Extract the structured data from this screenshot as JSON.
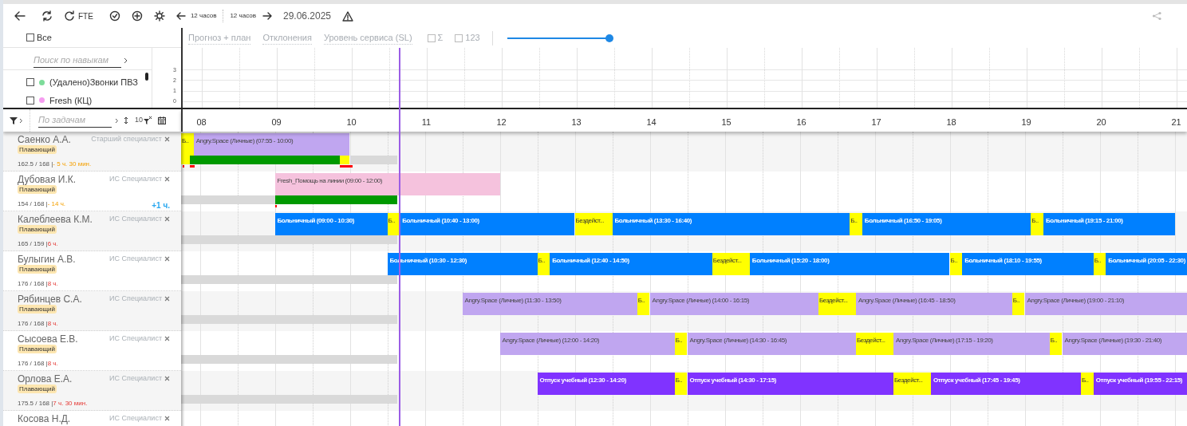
{
  "toolbar": {
    "fte_label": "FTE",
    "back_hours": "12 часов",
    "forward_hours": "12 часов",
    "date": "29.06.2025"
  },
  "view_tabs": {
    "select_all": {
      "label": "Все",
      "checked": false
    },
    "tabs": [
      {
        "label": "Прогноз + план",
        "selected": false
      },
      {
        "label": "Отклонения",
        "selected": false
      },
      {
        "label": "Уровень сервиса (SL)",
        "selected": false
      }
    ],
    "toggles": [
      {
        "label": "Σ",
        "checked": false
      },
      {
        "label": "123",
        "checked": false
      }
    ],
    "zoom_slider": {
      "level": 1
    }
  },
  "skills": {
    "search_placeholder": "Поиск по навыкам",
    "items": [
      {
        "label": "(Удалено)Звонки ПВЗ",
        "checked": false,
        "color": "#7ddc9a"
      },
      {
        "label": "Fresh (КЦ)",
        "checked": false,
        "color": "#f59cf0"
      }
    ]
  },
  "mini_chart": {
    "yticks": [
      "3",
      "2",
      "1",
      "0"
    ]
  },
  "task_filter": {
    "placeholder": "По задачам",
    "count": "10"
  },
  "timeline": {
    "hours": [
      "08",
      "09",
      "10",
      "11",
      "12",
      "13",
      "14",
      "15",
      "16",
      "17",
      "18",
      "19",
      "20",
      "21"
    ]
  },
  "employees": [
    {
      "name": "Саенко А.А.",
      "role": "Старший специалист",
      "badge": "Плавающий",
      "hours": "162.5 / 168 |",
      "delta": "- 5 ч. 30 мин.",
      "kind": "under",
      "shifts": [
        {
          "kind": "break",
          "label": "Б.."
        },
        {
          "kind": "personal",
          "label": "Angry.Space (Личные) (07:55 - 10:00)"
        }
      ],
      "adherence": [
        {
          "kind": "off"
        },
        {
          "kind": "ok"
        },
        {
          "kind": "off"
        },
        {
          "kind": "none"
        }
      ]
    },
    {
      "name": "Дубовая И.К.",
      "role": "ИС Специалист",
      "badge": "Плавающий",
      "hours": "154 / 168 |",
      "delta": "- 14 ч.",
      "kind": "under",
      "extra": "+1 ч.",
      "shifts": [
        {
          "kind": "task",
          "label": "Fresh_Помощь на линии (09:00 - 12:00)"
        }
      ],
      "adherence": [
        {
          "kind": "none"
        },
        {
          "kind": "ok"
        }
      ]
    },
    {
      "name": "Калеблеева К.М.",
      "role": "ИС Специалист",
      "badge": "Плавающий",
      "hours": "165 / 159 |",
      "delta": "6 ч.",
      "kind": "over",
      "shifts": [
        {
          "kind": "sick",
          "label": "Больничный (09:00 - 10:30)"
        },
        {
          "kind": "break",
          "label": "Б.."
        },
        {
          "kind": "sick",
          "label": "Больничный (10:40 - 13:00)"
        },
        {
          "kind": "break",
          "label": "Бездейст..."
        },
        {
          "kind": "sick",
          "label": "Больничный (13:30 - 16:40)"
        },
        {
          "kind": "break",
          "label": "Б.."
        },
        {
          "kind": "sick",
          "label": "Больничный (16:50 - 19:05)"
        },
        {
          "kind": "break",
          "label": "Б.."
        },
        {
          "kind": "sick",
          "label": "Больничный (19:15 - 21:00)"
        }
      ],
      "adherence": [
        {
          "kind": "none"
        }
      ]
    },
    {
      "name": "Булыгин А.В.",
      "role": "ИС Специалист",
      "badge": "Плавающий",
      "hours": "176 / 168 |",
      "delta": "8 ч.",
      "kind": "over",
      "shifts": [
        {
          "kind": "sick",
          "label": "Больничный (10:30 - 12:30)"
        },
        {
          "kind": "break",
          "label": "Б.."
        },
        {
          "kind": "sick",
          "label": "Больничный (12:40 - 14:50)"
        },
        {
          "kind": "break",
          "label": "Бездейст..."
        },
        {
          "kind": "sick",
          "label": "Больничный (15:20 - 18:00)"
        },
        {
          "kind": "break",
          "label": "Б.."
        },
        {
          "kind": "sick",
          "label": "Больничный (18:10 - 19:55)"
        },
        {
          "kind": "break",
          "label": "Б.."
        },
        {
          "kind": "sick",
          "label": "Больничный (20:05 - 22:30)"
        }
      ],
      "adherence": [
        {
          "kind": "none"
        }
      ]
    },
    {
      "name": "Рябинцев С.А.",
      "role": "ИС Специалист",
      "badge": "Плавающий",
      "hours": "176 / 168 |",
      "delta": "8 ч.",
      "kind": "over",
      "shifts": [
        {
          "kind": "personal",
          "label": "Angry.Space (Личные) (11:30 - 13:50)"
        },
        {
          "kind": "break",
          "label": "Б.."
        },
        {
          "kind": "personal",
          "label": "Angry.Space (Личные) (14:00 - 16:15)"
        },
        {
          "kind": "break",
          "label": "Бездейст..."
        },
        {
          "kind": "personal",
          "label": "Angry.Space (Личные) (16:45 - 18:50)"
        },
        {
          "kind": "break",
          "label": "Б.."
        },
        {
          "kind": "personal",
          "label": "Angry.Space (Личные) (19:00 - 21:10)"
        }
      ],
      "adherence": [
        {
          "kind": "none"
        }
      ]
    },
    {
      "name": "Сысоева Е.В.",
      "role": "ИС Специалист",
      "badge": "Плавающий",
      "hours": "176 / 168 |",
      "delta": "8 ч.",
      "kind": "over",
      "shifts": [
        {
          "kind": "personal",
          "label": "Angry.Space (Личные) (12:00 - 14:20)"
        },
        {
          "kind": "break",
          "label": "Б.."
        },
        {
          "kind": "personal",
          "label": "Angry.Space (Личные) (14:30 - 16:45)"
        },
        {
          "kind": "break",
          "label": "Бездейст..."
        },
        {
          "kind": "personal",
          "label": "Angry.Space (Личные) (17:15 - 19:20)"
        },
        {
          "kind": "break",
          "label": "Б.."
        },
        {
          "kind": "personal",
          "label": "Angry.Space (Личные) (19:30 - 21:40)"
        }
      ],
      "adherence": [
        {
          "kind": "none"
        }
      ]
    },
    {
      "name": "Орлова Е.А.",
      "role": "ИС Специалист",
      "badge": "Плавающий",
      "hours": "175.5 / 168 |",
      "delta": "7 ч. 30 мин.",
      "kind": "over",
      "shifts": [
        {
          "kind": "leave",
          "label": "Отпуск учебный (12:30 - 14:20)"
        },
        {
          "kind": "break",
          "label": "Б.."
        },
        {
          "kind": "leave",
          "label": "Отпуск учебный (14:30 - 17:15)"
        },
        {
          "kind": "break",
          "label": "Бездейст..."
        },
        {
          "kind": "leave",
          "label": "Отпуск учебный (17:45 - 19:45)"
        },
        {
          "kind": "break",
          "label": "Б.."
        },
        {
          "kind": "leave",
          "label": "Отпуск учебный (19:55 - 22:15)"
        }
      ],
      "adherence": [
        {
          "kind": "none"
        }
      ]
    },
    {
      "name": "Косова Н.Д.",
      "role": "ИС Специалист"
    }
  ]
}
